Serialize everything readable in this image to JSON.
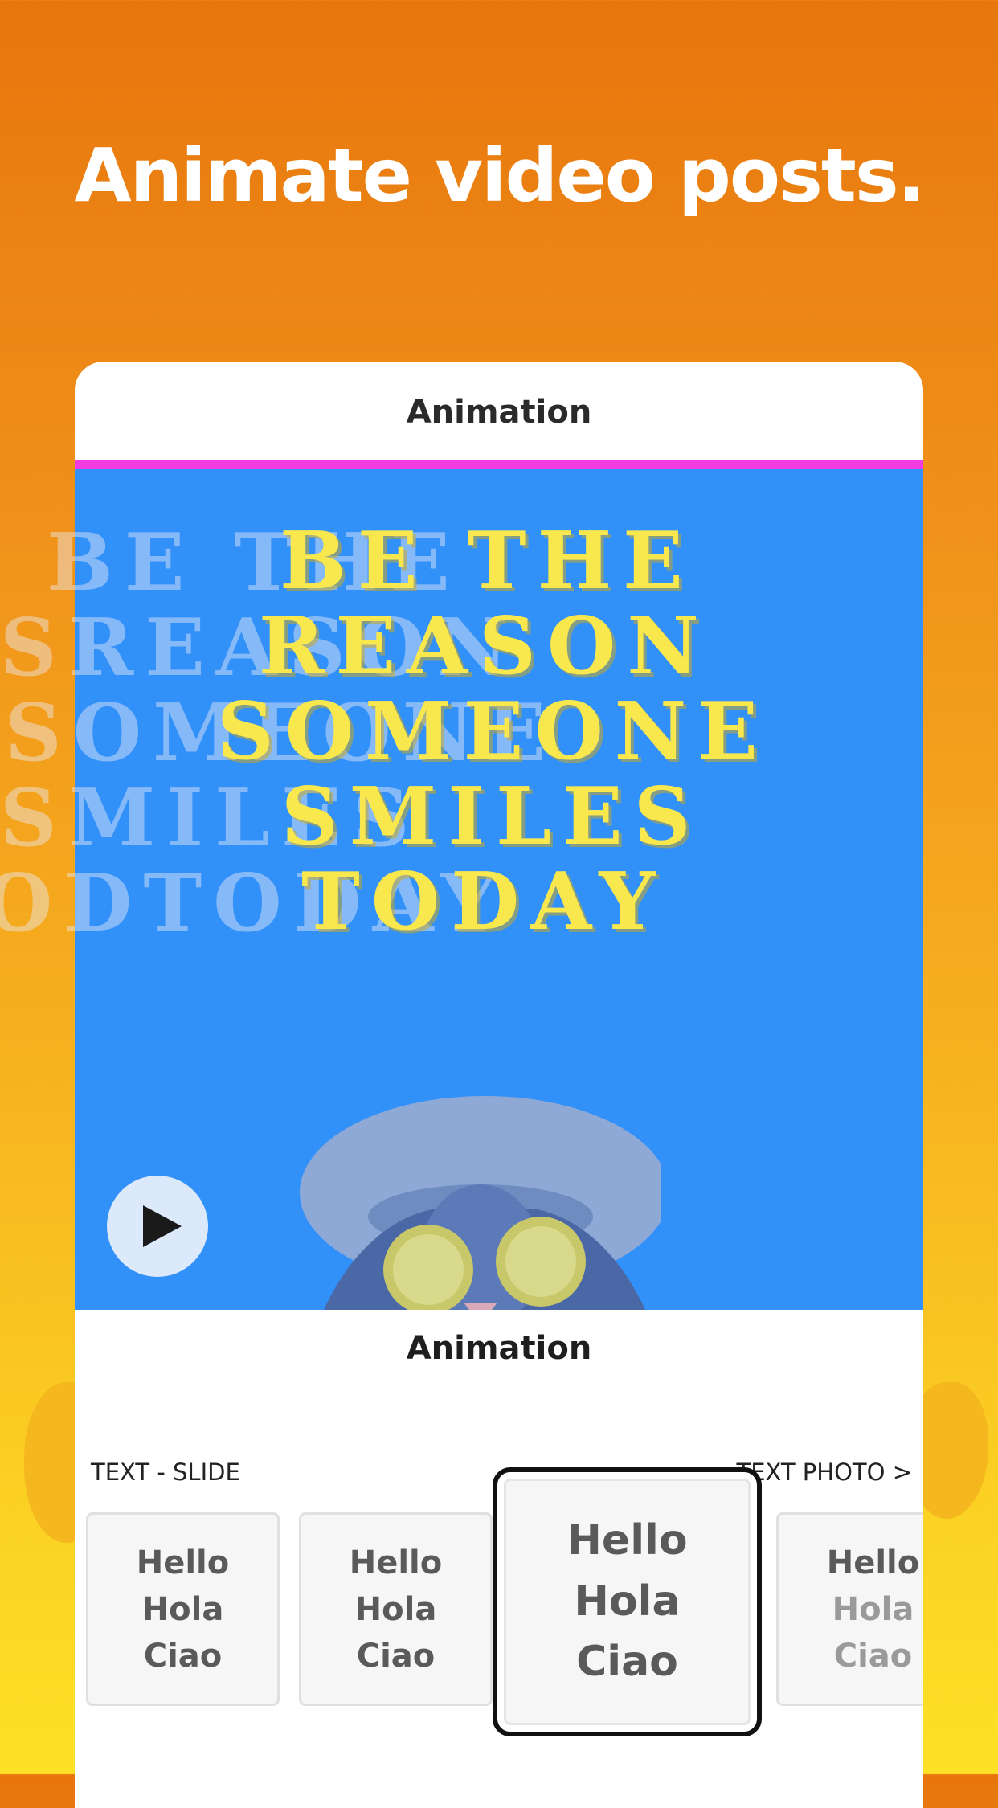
{
  "headline": "Animate video posts.",
  "card": {
    "title": "Animation",
    "preview": {
      "slogan_lines": [
        "BE THE",
        "REASON",
        "SOMEONE",
        "SMILES",
        "TODAY"
      ],
      "ghost_lines": [
        "BE  THE",
        "SREASON",
        "SOMEONE",
        "SMILES",
        "ODTODAY"
      ],
      "play_icon": "play-icon"
    },
    "section_title": "Animation",
    "category_left": "TEXT - SLIDE",
    "category_right": "TEXT  PHOTO >",
    "options": [
      {
        "line1": "Hello",
        "line2": "Hola",
        "line3": "Ciao"
      },
      {
        "line1": "Hello",
        "line2": "Hola",
        "line3": "Ciao"
      },
      {
        "line1": "Hello",
        "line2": "Hola",
        "line3": "Ciao"
      },
      {
        "line1": "Hello",
        "line2": "Hola",
        "line3": "Ciao"
      }
    ],
    "selected_option_index": 2
  },
  "colors": {
    "accent_bar": "#f03ce0",
    "preview_bg": "#3290f9",
    "slogan_text": "#f9e84d"
  }
}
